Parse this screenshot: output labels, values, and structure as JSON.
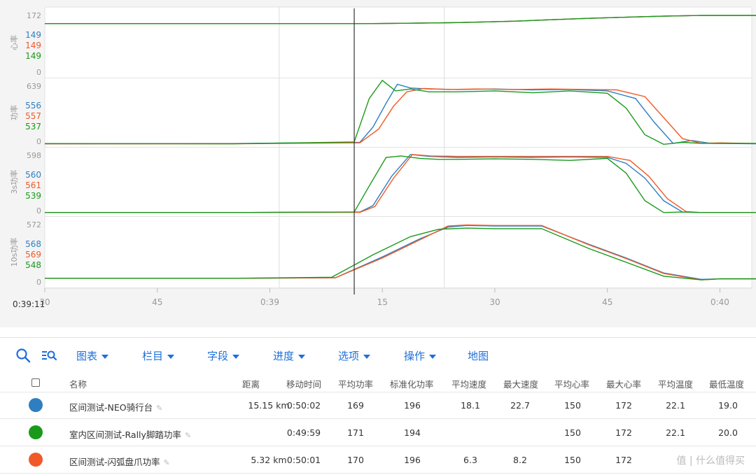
{
  "colors": {
    "neo": "#2d7fc1",
    "rally": "#1a9a1a",
    "flash": "#f05a28",
    "accent": "#1e6fd9"
  },
  "cursor_time": "0:39:11",
  "chart_data": [
    {
      "type": "line",
      "ylabel": "心率",
      "top_tick": "172",
      "zero_tick": "0",
      "ylim": [
        0,
        180
      ],
      "legend_values": [
        {
          "value": "149",
          "color_key": "neo"
        },
        {
          "value": "149",
          "color_key": "flash"
        },
        {
          "value": "149",
          "color_key": "rally"
        }
      ],
      "series": [
        {
          "name": "区间测试-NEO骑行台",
          "color_key": "neo",
          "x": [
            0,
            8,
            12,
            15,
            17,
            19,
            22,
            25,
            27,
            29,
            31,
            33,
            35,
            37,
            40,
            43,
            45
          ],
          "y": [
            149,
            149,
            149,
            149,
            149,
            150,
            152,
            156,
            160,
            164,
            167,
            170,
            172,
            172,
            172,
            172,
            172
          ]
        },
        {
          "name": "室内区间测试-Rally脚踏功率",
          "color_key": "rally",
          "x": [
            0,
            8,
            12,
            15,
            17,
            19,
            22,
            25,
            27,
            29,
            31,
            33,
            35,
            37,
            40,
            43,
            45
          ],
          "y": [
            149,
            149,
            149,
            149,
            149,
            150,
            152,
            156,
            160,
            164,
            167,
            170,
            172,
            172,
            172,
            171,
            172
          ]
        },
        {
          "name": "区间测试-闪弧盘爪功率",
          "color_key": "flash",
          "x": [
            0,
            8,
            12,
            15,
            17,
            19,
            22,
            25,
            27,
            29,
            31,
            33,
            35,
            37,
            40,
            43,
            45
          ],
          "y": [
            149,
            149,
            149,
            149,
            149,
            150,
            152,
            156,
            160,
            164,
            167,
            170,
            172,
            172,
            172,
            172,
            172
          ]
        }
      ]
    },
    {
      "type": "line",
      "ylabel": "功率",
      "top_tick": "639",
      "zero_tick": "0",
      "ylim": [
        0,
        660
      ],
      "legend_values": [
        {
          "value": "556",
          "color_key": "neo"
        },
        {
          "value": "557",
          "color_key": "flash"
        },
        {
          "value": "537",
          "color_key": "rally"
        }
      ],
      "series": [
        {
          "name": "区间测试-NEO骑行台",
          "color_key": "neo",
          "x": [
            0,
            10,
            16.8,
            17.5,
            18.2,
            18.8,
            19.5,
            20.5,
            22,
            24,
            26,
            28,
            30,
            31.5,
            32.5,
            33.5,
            34.5,
            35.5,
            38,
            42,
            45
          ],
          "y": [
            25,
            28,
            40,
            200,
            450,
            650,
            610,
            600,
            595,
            600,
            590,
            595,
            580,
            500,
            250,
            30,
            60,
            30,
            25,
            28,
            25
          ]
        },
        {
          "name": "室内区间测试-Rally脚踏功率",
          "color_key": "rally",
          "x": [
            0,
            10,
            16.5,
            17.3,
            18,
            18.7,
            19.5,
            20.5,
            22,
            24,
            26,
            28,
            30,
            31,
            32,
            33,
            34,
            35,
            38,
            42,
            45
          ],
          "y": [
            28,
            25,
            45,
            500,
            690,
            580,
            600,
            570,
            570,
            580,
            560,
            580,
            555,
            400,
            120,
            20,
            40,
            30,
            30,
            25,
            28
          ]
        },
        {
          "name": "区间测试-闪弧盘爪功率",
          "color_key": "flash",
          "x": [
            0,
            10,
            16.8,
            17.8,
            18.6,
            19.3,
            20.2,
            21.5,
            23,
            25,
            27,
            29,
            30.5,
            32,
            33,
            34,
            35,
            36,
            38,
            42,
            45
          ],
          "y": [
            25,
            26,
            35,
            180,
            420,
            570,
            605,
            595,
            600,
            595,
            600,
            595,
            590,
            520,
            300,
            80,
            30,
            35,
            28,
            26,
            25
          ]
        }
      ]
    },
    {
      "type": "line",
      "ylabel": "3s功率",
      "top_tick": "598",
      "zero_tick": "0",
      "ylim": [
        0,
        640
      ],
      "legend_values": [
        {
          "value": "560",
          "color_key": "neo"
        },
        {
          "value": "561",
          "color_key": "flash"
        },
        {
          "value": "539",
          "color_key": "rally"
        }
      ],
      "series": [
        {
          "name": "区间测试-NEO骑行台",
          "color_key": "neo",
          "x": [
            0,
            10,
            16.8,
            17.5,
            18.5,
            19.5,
            20.5,
            22,
            24,
            26,
            28,
            30,
            31,
            32,
            33,
            34,
            35,
            38,
            42,
            45
          ],
          "y": [
            30,
            30,
            35,
            100,
            400,
            620,
            600,
            590,
            595,
            590,
            595,
            590,
            530,
            380,
            150,
            35,
            30,
            30,
            30,
            30
          ]
        },
        {
          "name": "室内区间测试-Rally脚踏功率",
          "color_key": "rally",
          "x": [
            0,
            10,
            16.5,
            17.3,
            18.2,
            19,
            20,
            21,
            22,
            24,
            26,
            28,
            30,
            31,
            32,
            33,
            34,
            35,
            38,
            42,
            45
          ],
          "y": [
            30,
            30,
            35,
            300,
            590,
            605,
            580,
            570,
            570,
            575,
            570,
            560,
            580,
            430,
            150,
            30,
            35,
            30,
            30,
            30,
            30
          ]
        },
        {
          "name": "区间测试-闪弧盘爪功率",
          "color_key": "flash",
          "x": [
            0,
            10,
            16.8,
            17.6,
            18.6,
            19.6,
            20.6,
            22,
            24,
            26,
            28,
            30,
            31.2,
            32.2,
            33.2,
            34.2,
            35,
            38,
            42,
            45
          ],
          "y": [
            30,
            30,
            32,
            90,
            380,
            620,
            605,
            600,
            600,
            600,
            600,
            600,
            560,
            400,
            170,
            40,
            30,
            30,
            30,
            30
          ]
        }
      ]
    },
    {
      "type": "line",
      "ylabel": "10s功率",
      "top_tick": "572",
      "zero_tick": "0",
      "ylim": [
        0,
        610
      ],
      "legend_values": [
        {
          "value": "568",
          "color_key": "neo"
        },
        {
          "value": "569",
          "color_key": "flash"
        },
        {
          "value": "548",
          "color_key": "rally"
        }
      ],
      "series": [
        {
          "name": "区间测试-NEO骑行台",
          "color_key": "neo",
          "x": [
            0,
            10,
            15.5,
            18,
            20,
            21.5,
            22.5,
            24,
            25.5,
            26.5,
            29,
            31,
            33,
            35,
            36,
            38,
            42,
            45
          ],
          "y": [
            80,
            80,
            85,
            280,
            450,
            560,
            575,
            570,
            570,
            570,
            400,
            270,
            130,
            70,
            75,
            75,
            75,
            75
          ]
        },
        {
          "name": "室内区间测试-Rally脚踏功率",
          "color_key": "rally",
          "x": [
            0,
            10,
            15.3,
            17.5,
            19.5,
            21,
            22.5,
            24,
            25.5,
            26.5,
            29,
            31,
            33,
            35,
            36,
            38,
            42,
            45
          ],
          "y": [
            80,
            80,
            90,
            300,
            470,
            540,
            550,
            545,
            545,
            545,
            360,
            230,
            100,
            65,
            75,
            75,
            75,
            75
          ]
        },
        {
          "name": "区间测试-闪弧盘爪功率",
          "color_key": "flash",
          "x": [
            0,
            10,
            15.5,
            18,
            20,
            21.5,
            22.5,
            24,
            25.5,
            26.5,
            29,
            31,
            33,
            35,
            36,
            38,
            42,
            45
          ],
          "y": [
            80,
            80,
            85,
            270,
            440,
            570,
            580,
            575,
            575,
            575,
            395,
            265,
            125,
            65,
            75,
            75,
            75,
            75
          ]
        }
      ]
    }
  ],
  "x_ticks": [
    {
      "x": 0,
      "label": "30"
    },
    {
      "x": 6,
      "label": "45"
    },
    {
      "x": 12,
      "label": "0:39"
    },
    {
      "x": 18,
      "label": "15"
    },
    {
      "x": 24,
      "label": "30"
    },
    {
      "x": 30,
      "label": "45"
    },
    {
      "x": 36,
      "label": "0:40"
    }
  ],
  "x_range": [
    0,
    37.7
  ],
  "highlight_range": [
    12.5,
    21.3
  ],
  "cursor_x": 16.5,
  "toolbar": {
    "search_icon": "search-icon",
    "zoom_icon": "zoom-list-icon",
    "menus": [
      "图表",
      "栏目",
      "字段",
      "进度",
      "选项",
      "操作"
    ],
    "map": "地图"
  },
  "table": {
    "headers": [
      "名称",
      "距离",
      "移动时间",
      "平均功率",
      "标准化功率",
      "平均速度",
      "最大速度",
      "平均心率",
      "最大心率",
      "平均温度",
      "最低温度"
    ],
    "rows": [
      {
        "color_key": "neo",
        "name": "区间测试-NEO骑行台",
        "cells": [
          "15.15 km",
          "0:50:02",
          "169",
          "196",
          "18.1",
          "22.7",
          "150",
          "172",
          "22.1",
          "19.0"
        ]
      },
      {
        "color_key": "rally",
        "name": "室内区间测试-Rally脚踏功率",
        "cells": [
          "",
          "0:49:59",
          "171",
          "194",
          "",
          "",
          "150",
          "172",
          "22.1",
          "20.0"
        ]
      },
      {
        "color_key": "flash",
        "name": "区间测试-闪弧盘爪功率",
        "cells": [
          "5.32 km",
          "0:50:01",
          "170",
          "196",
          "6.3",
          "8.2",
          "150",
          "172",
          "",
          ""
        ]
      }
    ]
  }
}
